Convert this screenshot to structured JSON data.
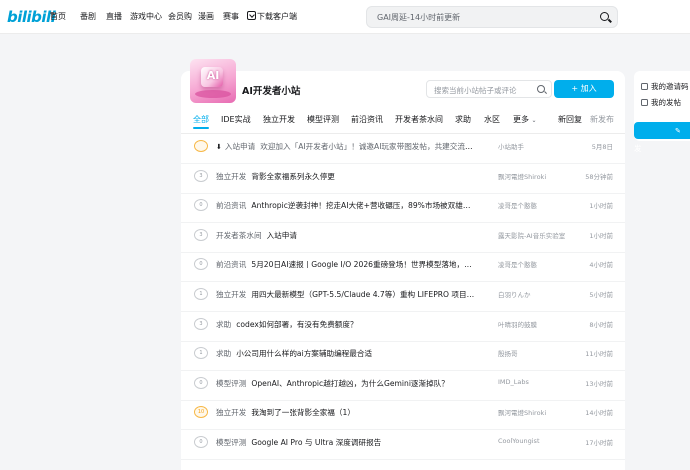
{
  "brand": {
    "logo": "bilibili"
  },
  "nav": {
    "home": "首页",
    "anime": "番剧",
    "live": "直播",
    "game_center": "游戏中心",
    "vip_mall": "会员购",
    "manga": "漫画",
    "esports": "赛事",
    "download": "下载客户端"
  },
  "header_search": {
    "placeholder": "GAI周延-14小时前更新"
  },
  "community": {
    "title": "AI开发者小站",
    "avatar_text": "AI",
    "search_placeholder": "搜索当前小站帖子或评论",
    "join_label": "+ 加入"
  },
  "tabs": {
    "all": "全部",
    "ide": "IDE实战",
    "indie": "独立开发",
    "model_review": "模型评测",
    "frontier": "前沿资讯",
    "water": "开发者茶水间",
    "help": "求助",
    "zone": "水区",
    "more": "更多",
    "sort_reply": "回复",
    "sort_new": "新发布"
  },
  "sort_prefix": "新",
  "rows": [
    {
      "badge": "",
      "pinned": true,
      "category": "入站申请",
      "title": "欢迎加入「AI开发者小站」！诚邀AI玩家带图发帖，共建交流论坛！",
      "author": "小站助手",
      "time": "5月8日",
      "hot": true
    },
    {
      "badge": "3",
      "pinned": false,
      "category": "独立开发",
      "title": "背影全家福系列永久停更",
      "author": "飘河電燈Shiroki",
      "time": "58分钟前",
      "hot": false
    },
    {
      "badge": "0",
      "pinned": false,
      "category": "前沿资讯",
      "title": "Anthropic逆袭封神！挖走AI大佬+营收碾压，89%市场被双雄包揽，A...",
      "author": "凌哥是个憨憨",
      "time": "1小时前",
      "hot": false
    },
    {
      "badge": "3",
      "pinned": false,
      "category": "开发者茶水间",
      "title": "入站申请",
      "author": "露天影院-AI音乐实验室",
      "time": "1小时前",
      "hot": false
    },
    {
      "badge": "0",
      "pinned": false,
      "category": "前沿资讯",
      "title": "5月20日AI速报丨Google I/O 2026重磅登场！世界模型落地，全民智...",
      "author": "凌哥是个憨憨",
      "time": "4小时前",
      "hot": false
    },
    {
      "badge": "1",
      "pinned": false,
      "category": "独立开发",
      "title": "用四大最新模型（GPT-5.5/Claude 4.7等）重构 LIFEPRO 项目的世...",
      "author": "白羽りんか",
      "time": "5小时前",
      "hot": false
    },
    {
      "badge": "3",
      "pinned": false,
      "category": "求助",
      "title": "codex如何部署，有没有免费额度？",
      "author": "叶晴羽的鼓膜",
      "time": "8小时前",
      "hot": false
    },
    {
      "badge": "1",
      "pinned": false,
      "category": "求助",
      "title": "小公司用什么样的ai方案辅助编程最合适",
      "author": "殷扬哥",
      "time": "11小时前",
      "hot": false
    },
    {
      "badge": "0",
      "pinned": false,
      "category": "模型评测",
      "title": "OpenAI、Anthropic越打越凶，为什么Gemini逐渐掉队？",
      "author": "IMD_Labs",
      "time": "13小时前",
      "hot": false
    },
    {
      "badge": "10",
      "pinned": false,
      "category": "独立开发",
      "title": "我淘到了一张背影全家福（1）",
      "author": "飘河電燈Shiroki",
      "time": "14小时前",
      "hot": true
    },
    {
      "badge": "0",
      "pinned": false,
      "category": "模型评测",
      "title": "Google AI Pro 与 Ultra 深度调研报告",
      "author": "CoolYoungist",
      "time": "17小时前",
      "hot": false
    }
  ],
  "sidebar": {
    "invite": "我的邀请码",
    "my_posts": "我的发帖",
    "post_button": "发"
  },
  "colors": {
    "accent": "#00aeec",
    "hot": "#f7a318",
    "brand": "#00a1d6"
  }
}
